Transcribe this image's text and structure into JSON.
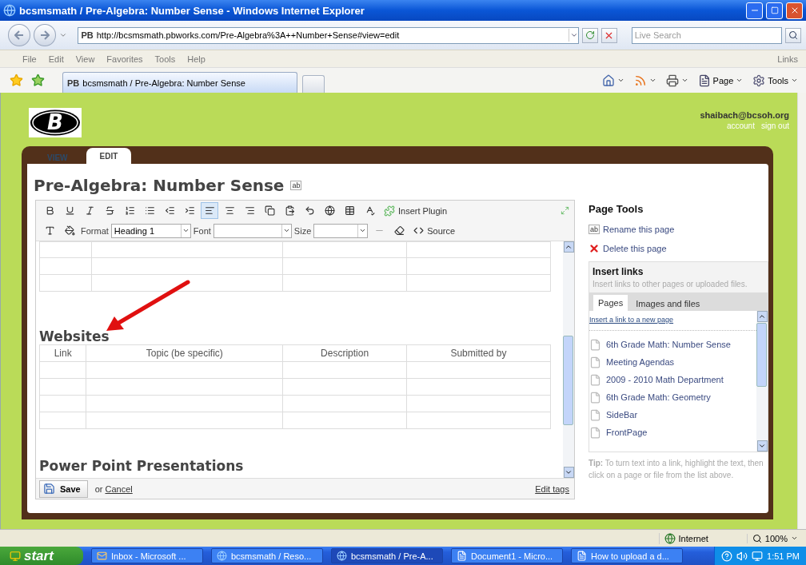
{
  "window": {
    "title": "bcsmsmath / Pre-Algebra:  Number Sense - Windows Internet Explorer"
  },
  "address_bar": {
    "favicon": "PB",
    "url": "http://bcsmsmath.pbworks.com/Pre-Algebra%3A++Number+Sense#view=edit",
    "search_placeholder": "Live Search"
  },
  "menu": [
    "File",
    "Edit",
    "View",
    "Favorites",
    "Tools",
    "Help"
  ],
  "links_label": "Links",
  "browser_tab": {
    "favicon": "PB",
    "title": "bcsmsmath / Pre-Algebra:  Number Sense"
  },
  "command_bar": [
    {
      "kind": "home"
    },
    {
      "kind": "feeds"
    },
    {
      "kind": "print"
    },
    {
      "kind": "page",
      "label": "Page"
    },
    {
      "kind": "tools",
      "label": "Tools"
    }
  ],
  "site": {
    "logo_letter": "B",
    "user": "shaibach@bcsoh.org",
    "user_links": [
      "account",
      "sign out"
    ],
    "tabs": [
      {
        "label": "VIEW",
        "selected": false
      },
      {
        "label": "EDIT",
        "selected": true
      }
    ],
    "page_title": "Pre-Algebra:  Number Sense",
    "rename_glyph": "ab",
    "toolbar": [
      {
        "kind": "bold",
        "selected": false
      },
      {
        "kind": "underline",
        "selected": false
      },
      {
        "kind": "italic",
        "selected": false
      },
      {
        "kind": "strike",
        "selected": false
      },
      {
        "kind": "ordered-list",
        "selected": false
      },
      {
        "kind": "bullet-list",
        "selected": false
      },
      {
        "kind": "outdent",
        "selected": false
      },
      {
        "kind": "indent",
        "selected": false
      },
      {
        "kind": "align-left",
        "selected": true
      },
      {
        "kind": "align-center",
        "selected": false
      },
      {
        "kind": "align-right",
        "selected": false
      },
      {
        "kind": "copy",
        "selected": false
      },
      {
        "kind": "paste",
        "selected": false
      },
      {
        "kind": "undo",
        "selected": false
      },
      {
        "kind": "link",
        "selected": false
      },
      {
        "kind": "table",
        "selected": false
      },
      {
        "kind": "spellcheck",
        "selected": false
      }
    ],
    "insert_plugin": "Insert Plugin",
    "format": {
      "label": "Format",
      "value": "Heading 1"
    },
    "font": {
      "label": "Font"
    },
    "size": {
      "label": "Size"
    },
    "source": "Source",
    "sections": [
      {
        "heading": "Websites",
        "columns": [
          "Link",
          "Topic (be specific)",
          "Description",
          "Submitted by"
        ]
      },
      {
        "heading": "Power Point Presentations"
      }
    ],
    "footer": {
      "save": "Save",
      "or": "or",
      "cancel": "Cancel",
      "edit_tags": "Edit tags"
    },
    "page_tools": {
      "title": "Page Tools",
      "actions": [
        {
          "kind": "rename",
          "glyph": "ab",
          "label": "Rename this page"
        },
        {
          "kind": "delete",
          "label": "Delete this page"
        }
      ]
    },
    "insert_links": {
      "title": "Insert links",
      "subtitle": "Insert links to other pages or uploaded files.",
      "tabs": [
        {
          "label": "Pages",
          "selected": true
        },
        {
          "label": "Images and files",
          "selected": false
        }
      ],
      "new_page_link": "Insert a link to a new page",
      "pages": [
        "6th Grade Math: Number Sense",
        "Meeting Agendas",
        "2009 - 2010 Math Department",
        "6th Grade Math: Geometry",
        "SideBar",
        "FrontPage"
      ],
      "tip": "**Tip:** To turn text into a link, highlight the text, then click on a page or file from the list above."
    }
  },
  "status_bar": {
    "zone": "Internet",
    "zoom": "100%"
  },
  "taskbar": {
    "start": "start",
    "items": [
      {
        "kind": "mail",
        "label": "Inbox - Microsoft ...",
        "selected": false
      },
      {
        "kind": "browser",
        "label": "bcsmsmath / Reso...",
        "selected": false
      },
      {
        "kind": "browser",
        "label": "bcsmsmath / Pre-A...",
        "selected": true
      },
      {
        "kind": "document",
        "label": "Document1 - Micro...",
        "selected": false
      },
      {
        "kind": "document",
        "label": "How to upload a d...",
        "selected": false
      }
    ],
    "time": "1:51 PM"
  }
}
